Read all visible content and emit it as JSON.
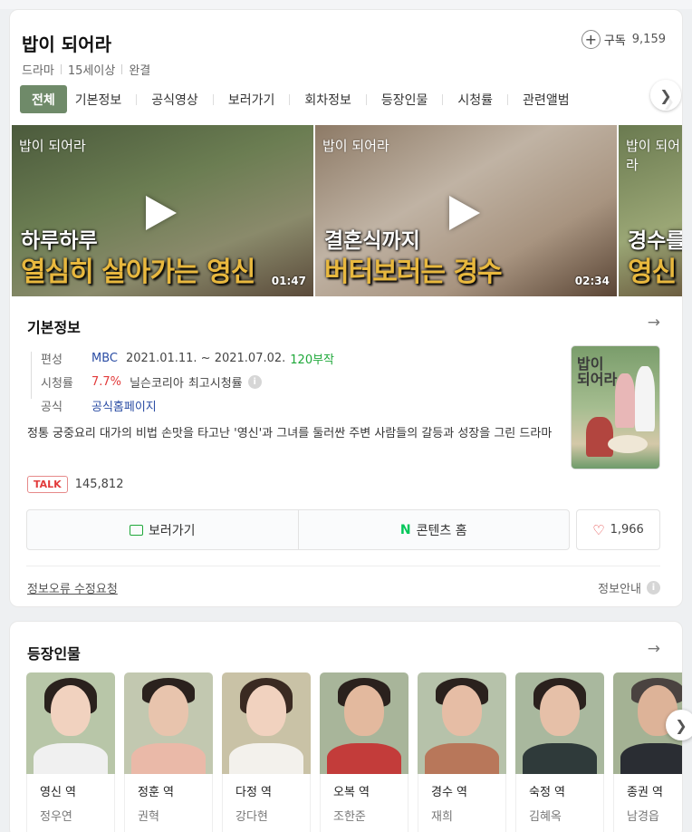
{
  "header": {
    "title": "밥이 되어라",
    "subscribe_label": "구독",
    "subscribe_count": "9,159",
    "meta": [
      "드라마",
      "15세이상",
      "완결"
    ]
  },
  "tabs": [
    "전체",
    "기본정보",
    "공식영상",
    "보러가기",
    "회차정보",
    "등장인물",
    "시청률",
    "관련앨범"
  ],
  "videos": [
    {
      "logo": "밥이 되어라",
      "caption1": "하루하루",
      "caption2": "열심히 살아가는 영신",
      "duration": "01:47"
    },
    {
      "logo": "밥이 되어라",
      "caption1": "결혼식까지",
      "caption2": "버터보러는 경수",
      "duration": "02:34"
    },
    {
      "logo": "밥이 되어라",
      "caption1": "경수를",
      "caption2": "영신"
    }
  ],
  "basic_info": {
    "title": "기본정보",
    "rows": {
      "broadcast_label": "편성",
      "channel": "MBC",
      "period": "2021.01.11. ~ 2021.07.02.",
      "episodes": "120부작",
      "rating_label": "시청률",
      "rating_value": "7.7%",
      "rating_source": "닐슨코리아",
      "rating_note": "최고시청률",
      "official_label": "공식",
      "official_link": "공식홈페이지"
    },
    "poster_title": "밥이\n되어라",
    "description": "정통 궁중요리 대가의 비법 손맛을 타고난 '영신'과 그녀를 둘러싼 주변 사람들의 갈등과 성장을 그린 드라마",
    "talk_badge": "TALK",
    "talk_count": "145,812",
    "watch_label": "보러가기",
    "content_home_label": "콘텐츠 홈",
    "like_count": "1,966",
    "report_label": "정보오류 수정요청",
    "guide_label": "정보안내"
  },
  "cast": {
    "title": "등장인물",
    "items": [
      {
        "role": "영신 역",
        "actor": "정우연"
      },
      {
        "role": "정훈 역",
        "actor": "권혁"
      },
      {
        "role": "다정 역",
        "actor": "강다현"
      },
      {
        "role": "오복 역",
        "actor": "조한준"
      },
      {
        "role": "경수 역",
        "actor": "재희"
      },
      {
        "role": "숙정 역",
        "actor": "김혜옥"
      },
      {
        "role": "종권 역",
        "actor": "남경읍"
      }
    ]
  },
  "colors": {
    "active_tab": "#6f8a69",
    "link_blue": "#2b4da4",
    "rating_red": "#e23b3b",
    "episodes_green": "#1fa83a",
    "naver_green": "#03c75a"
  }
}
